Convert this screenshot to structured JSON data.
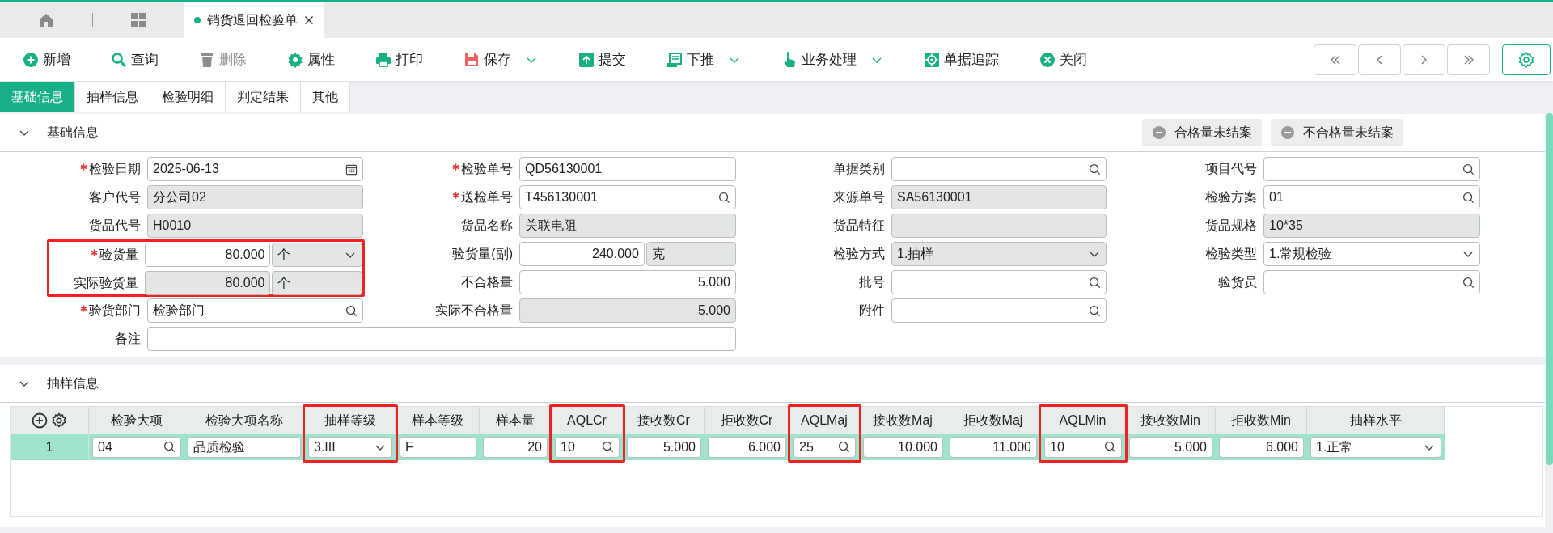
{
  "doc_tabs": [
    {
      "label": "销货退回检验单",
      "selected": true
    }
  ],
  "toolbar": [
    {
      "kind": "add",
      "label": "新增",
      "disabled": false,
      "dropdown": false
    },
    {
      "kind": "query",
      "label": "查询",
      "disabled": false,
      "dropdown": false
    },
    {
      "kind": "delete",
      "label": "删除",
      "disabled": true,
      "dropdown": false
    },
    {
      "kind": "properties",
      "label": "属性",
      "disabled": false,
      "dropdown": false
    },
    {
      "kind": "print",
      "label": "打印",
      "disabled": false,
      "dropdown": false
    },
    {
      "kind": "save",
      "label": "保存",
      "disabled": false,
      "dropdown": true
    },
    {
      "kind": "submit",
      "label": "提交",
      "disabled": false,
      "dropdown": false
    },
    {
      "kind": "push",
      "label": "下推",
      "disabled": false,
      "dropdown": true
    },
    {
      "kind": "process",
      "label": "业务处理",
      "disabled": false,
      "dropdown": true
    },
    {
      "kind": "trace",
      "label": "单据追踪",
      "disabled": false,
      "dropdown": false
    },
    {
      "kind": "close",
      "label": "关闭",
      "disabled": false,
      "dropdown": false
    }
  ],
  "form_tabs": [
    {
      "label": "基础信息",
      "selected": true
    },
    {
      "label": "抽样信息",
      "selected": false
    },
    {
      "label": "检验明细",
      "selected": false
    },
    {
      "label": "判定结果",
      "selected": false
    },
    {
      "label": "其他",
      "selected": false
    }
  ],
  "basic_section": {
    "title": "基础信息",
    "expanded": true,
    "buttons": [
      "合格量未结案",
      "不合格量未结案"
    ],
    "columns": [
      [
        {
          "label": "检验日期",
          "required": true,
          "kind": "date",
          "value": "2025-06-13",
          "readonly": false,
          "highlighted": false
        },
        {
          "label": "客户代号",
          "required": false,
          "kind": "text",
          "value": "分公司02",
          "readonly": true,
          "highlighted": false
        },
        {
          "label": "货品代号",
          "required": false,
          "kind": "text",
          "value": "H0010",
          "readonly": true,
          "highlighted": false
        },
        {
          "label": "验货量",
          "required": true,
          "kind": "quantity",
          "value": "80.000",
          "readonly": false,
          "unit": "个",
          "unit_select": true,
          "highlighted": true
        },
        {
          "label": "实际验货量",
          "required": false,
          "kind": "quantity",
          "value": "80.000",
          "readonly": true,
          "unit": "个",
          "unit_select": false,
          "highlighted": true
        },
        {
          "label": "验货部门",
          "required": true,
          "kind": "lookup",
          "value": "检验部门",
          "readonly": false,
          "highlighted": false
        },
        {
          "label": "备注",
          "required": false,
          "kind": "wide",
          "readonly": false,
          "highlighted": false
        }
      ],
      [
        {
          "label": "检验单号",
          "required": true,
          "kind": "text",
          "value": "QD56130001",
          "readonly": false,
          "highlighted": false
        },
        {
          "label": "送检单号",
          "required": true,
          "kind": "lookup",
          "value": "T456130001",
          "readonly": false,
          "highlighted": false
        },
        {
          "label": "货品名称",
          "required": false,
          "kind": "text",
          "value": "关联电阻",
          "readonly": true,
          "highlighted": false
        },
        {
          "label": "验货量(副)",
          "required": false,
          "kind": "quantity",
          "value": "240.000",
          "readonly": false,
          "unit": "克",
          "unit_select": false,
          "highlighted": false
        },
        {
          "label": "不合格量",
          "required": false,
          "kind": "number",
          "value": "5.000",
          "readonly": false,
          "highlighted": false
        },
        {
          "label": "实际不合格量",
          "required": false,
          "kind": "number",
          "value": "5.000",
          "readonly": true,
          "highlighted": false
        }
      ],
      [
        {
          "label": "单据类别",
          "required": false,
          "kind": "lookup",
          "readonly": false,
          "highlighted": false
        },
        {
          "label": "来源单号",
          "required": false,
          "kind": "text",
          "value": "SA56130001",
          "readonly": true,
          "highlighted": false
        },
        {
          "label": "货品特征",
          "required": false,
          "kind": "text",
          "readonly": true,
          "highlighted": false
        },
        {
          "label": "检验方式",
          "required": false,
          "kind": "select",
          "value": "1.抽样",
          "readonly": true,
          "highlighted": false
        },
        {
          "label": "批号",
          "required": false,
          "kind": "lookup",
          "readonly": false,
          "highlighted": false
        },
        {
          "label": "附件",
          "required": false,
          "kind": "lookup",
          "readonly": false,
          "highlighted": false
        }
      ],
      [
        {
          "label": "项目代号",
          "required": false,
          "kind": "lookup",
          "readonly": false,
          "highlighted": false
        },
        {
          "label": "检验方案",
          "required": false,
          "kind": "lookup",
          "value": "01",
          "readonly": false,
          "highlighted": false
        },
        {
          "label": "货品规格",
          "required": false,
          "kind": "text",
          "value": "10*35",
          "readonly": true,
          "highlighted": false
        },
        {
          "label": "检验类型",
          "required": false,
          "kind": "select",
          "value": "1.常规检验",
          "readonly": false,
          "highlighted": false
        },
        {
          "label": "验货员",
          "required": false,
          "kind": "lookup",
          "readonly": false,
          "highlighted": false
        }
      ]
    ]
  },
  "sampling_section": {
    "title": "抽样信息",
    "expanded": true,
    "table": {
      "columns": [
        {
          "label": "检验大项",
          "highlighted": false
        },
        {
          "label": "检验大项名称",
          "highlighted": false
        },
        {
          "label": "抽样等级",
          "highlighted": true
        },
        {
          "label": "样本等级",
          "highlighted": false
        },
        {
          "label": "样本量",
          "highlighted": false
        },
        {
          "label": "AQLCr",
          "highlighted": true
        },
        {
          "label": "接收数Cr",
          "highlighted": false
        },
        {
          "label": "拒收数Cr",
          "highlighted": false
        },
        {
          "label": "AQLMaj",
          "highlighted": true
        },
        {
          "label": "接收数Maj",
          "highlighted": false
        },
        {
          "label": "拒收数Maj",
          "highlighted": false
        },
        {
          "label": "AQLMin",
          "highlighted": true
        },
        {
          "label": "接收数Min",
          "highlighted": false
        },
        {
          "label": "拒收数Min",
          "highlighted": false
        },
        {
          "label": "抽样水平",
          "highlighted": false
        }
      ],
      "rows": [
        {
          "number": "1",
          "selected": true,
          "cells": [
            {
              "kind": "lookup",
              "value": "04"
            },
            {
              "kind": "text",
              "value": "品质检验"
            },
            {
              "kind": "select",
              "value": "3.III"
            },
            {
              "kind": "text",
              "value": "F"
            },
            {
              "kind": "number",
              "value": "20"
            },
            {
              "kind": "lookup",
              "value": "10"
            },
            {
              "kind": "number",
              "value": "5.000"
            },
            {
              "kind": "number",
              "value": "6.000"
            },
            {
              "kind": "lookup",
              "value": "25"
            },
            {
              "kind": "number",
              "value": "10.000"
            },
            {
              "kind": "number",
              "value": "11.000"
            },
            {
              "kind": "lookup",
              "value": "10"
            },
            {
              "kind": "number",
              "value": "5.000"
            },
            {
              "kind": "number",
              "value": "6.000"
            },
            {
              "kind": "select",
              "value": "1.正常"
            }
          ]
        }
      ]
    }
  }
}
